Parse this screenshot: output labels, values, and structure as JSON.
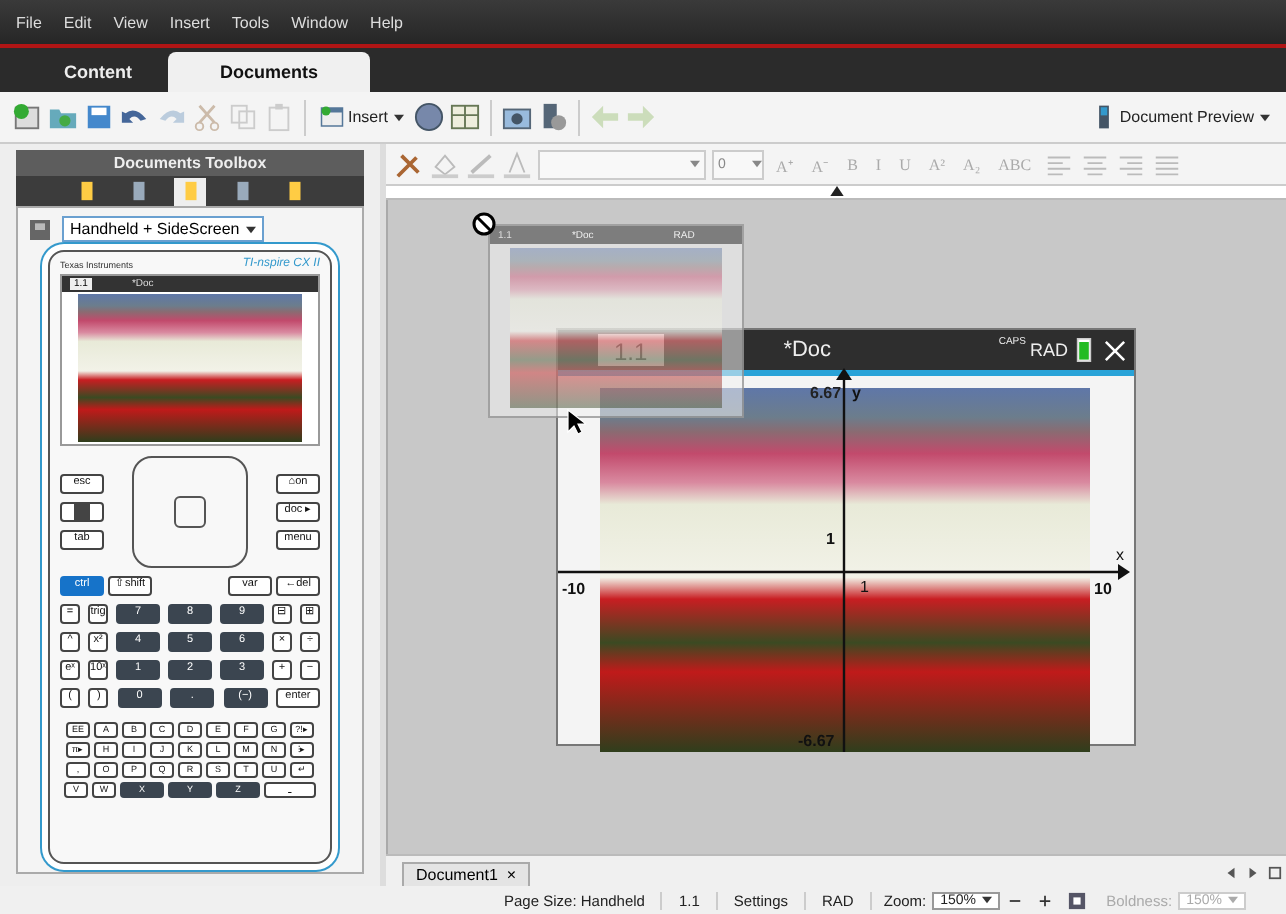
{
  "menu": [
    "File",
    "Edit",
    "View",
    "Insert",
    "Tools",
    "Window",
    "Help"
  ],
  "tabs": [
    {
      "label": "Content",
      "selected": false
    },
    {
      "label": "Documents",
      "selected": true
    }
  ],
  "toolbar": {
    "insert": "Insert",
    "preview": "Document Preview"
  },
  "toolbox": {
    "title": "Documents Toolbox",
    "tool_tabs": [
      {
        "selected": false
      },
      {
        "selected": false
      },
      {
        "selected": true
      },
      {
        "selected": false
      },
      {
        "selected": false
      }
    ],
    "view": "Handheld + SideScreen"
  },
  "calculator": {
    "brand": "Texas Instruments",
    "model": "TI-nspire CX II",
    "screen_tab": "1.1",
    "screen_title": "*Doc",
    "nav_left": [
      {
        "label": "esc",
        "kind": "light"
      },
      {
        "kind": "icon"
      },
      {
        "label": "tab",
        "kind": "light"
      }
    ],
    "nav_right": [
      {
        "label": "⌂on"
      },
      {
        "label": "doc ▸"
      },
      {
        "label": "menu"
      }
    ],
    "key_rows": [
      [
        {
          "label": "ctrl",
          "kind": "accent"
        },
        {
          "label": "⇧shift",
          "kind": "light"
        },
        {
          "kind": "spacer"
        },
        {
          "label": "var",
          "kind": "light"
        },
        {
          "label": "←del",
          "kind": "light"
        }
      ],
      [
        {
          "label": "=",
          "kind": "small"
        },
        {
          "label": "trig",
          "kind": "small"
        },
        {
          "label": "7",
          "kind": "dark"
        },
        {
          "label": "8",
          "kind": "dark"
        },
        {
          "label": "9",
          "kind": "dark"
        },
        {
          "label": "⊟",
          "kind": "small"
        },
        {
          "label": "⊞",
          "kind": "small"
        }
      ],
      [
        {
          "label": "^",
          "kind": "small"
        },
        {
          "label": "x²",
          "kind": "small"
        },
        {
          "label": "4",
          "kind": "dark"
        },
        {
          "label": "5",
          "kind": "dark"
        },
        {
          "label": "6",
          "kind": "dark"
        },
        {
          "label": "×",
          "kind": "small"
        },
        {
          "label": "÷",
          "kind": "small"
        }
      ],
      [
        {
          "label": "eˣ",
          "kind": "small"
        },
        {
          "label": "10ˣ",
          "kind": "small"
        },
        {
          "label": "1",
          "kind": "dark"
        },
        {
          "label": "2",
          "kind": "dark"
        },
        {
          "label": "3",
          "kind": "dark"
        },
        {
          "label": "+",
          "kind": "small"
        },
        {
          "label": "−",
          "kind": "small"
        }
      ],
      [
        {
          "label": "(",
          "kind": "small"
        },
        {
          "label": ")",
          "kind": "small"
        },
        {
          "label": "0",
          "kind": "dark"
        },
        {
          "label": ".",
          "kind": "dark"
        },
        {
          "label": "(−)",
          "kind": "dark"
        },
        {
          "label": "enter",
          "kind": "light"
        }
      ]
    ],
    "letter_rows": [
      [
        {
          "label": "EE",
          "kind": "light"
        },
        {
          "label": "A",
          "kind": "light"
        },
        {
          "label": "B",
          "kind": "light"
        },
        {
          "label": "C",
          "kind": "light"
        },
        {
          "label": "D",
          "kind": "light"
        },
        {
          "label": "E",
          "kind": "light"
        },
        {
          "label": "F",
          "kind": "light"
        },
        {
          "label": "G",
          "kind": "light"
        },
        {
          "label": "?!▸",
          "kind": "light"
        }
      ],
      [
        {
          "label": "π▸",
          "kind": "light"
        },
        {
          "label": "H",
          "kind": "light"
        },
        {
          "label": "I",
          "kind": "light"
        },
        {
          "label": "J",
          "kind": "light"
        },
        {
          "label": "K",
          "kind": "light"
        },
        {
          "label": "L",
          "kind": "light"
        },
        {
          "label": "M",
          "kind": "light"
        },
        {
          "label": "N",
          "kind": "light"
        },
        {
          "label": "⁝▸",
          "kind": "light"
        }
      ],
      [
        {
          "label": ",",
          "kind": "light"
        },
        {
          "label": "O",
          "kind": "light"
        },
        {
          "label": "P",
          "kind": "light"
        },
        {
          "label": "Q",
          "kind": "light"
        },
        {
          "label": "R",
          "kind": "light"
        },
        {
          "label": "S",
          "kind": "light"
        },
        {
          "label": "T",
          "kind": "light"
        },
        {
          "label": "U",
          "kind": "light"
        },
        {
          "label": "↵",
          "kind": "light"
        }
      ],
      [
        {
          "label": "V",
          "kind": "light"
        },
        {
          "label": "W",
          "kind": "light"
        },
        {
          "label": "X",
          "kind": "dark"
        },
        {
          "label": "Y",
          "kind": "dark"
        },
        {
          "label": "Z",
          "kind": "dark"
        },
        {
          "label": "⎵",
          "kind": "wide"
        }
      ]
    ]
  },
  "format_bar": {
    "font_size": "0",
    "buttons": [
      "A⁺",
      "A⁻",
      "B",
      "I",
      "U",
      "A²",
      "A₂",
      "ABC"
    ]
  },
  "ghost": {
    "tab": "1.1",
    "title": "*Doc",
    "mode": "RAD"
  },
  "handheld": {
    "tab": "1.1",
    "title": "*Doc",
    "caps": "CAPS",
    "mode": "RAD",
    "ymax": "6.67",
    "ylabel": "y",
    "xmin": "-10",
    "xmax": "10",
    "xlabel": "x",
    "ytick": "1",
    "xtick": "1",
    "ymin": "-6.67"
  },
  "doc_tabs": [
    {
      "label": "Document1",
      "close": "×"
    }
  ],
  "status": {
    "page_size": "Page Size: Handheld",
    "page": "1.1",
    "settings": "Settings",
    "mode": "RAD",
    "zoom_label": "Zoom:",
    "zoom": "150%",
    "boldness_label": "Boldness:",
    "boldness": "150%"
  }
}
